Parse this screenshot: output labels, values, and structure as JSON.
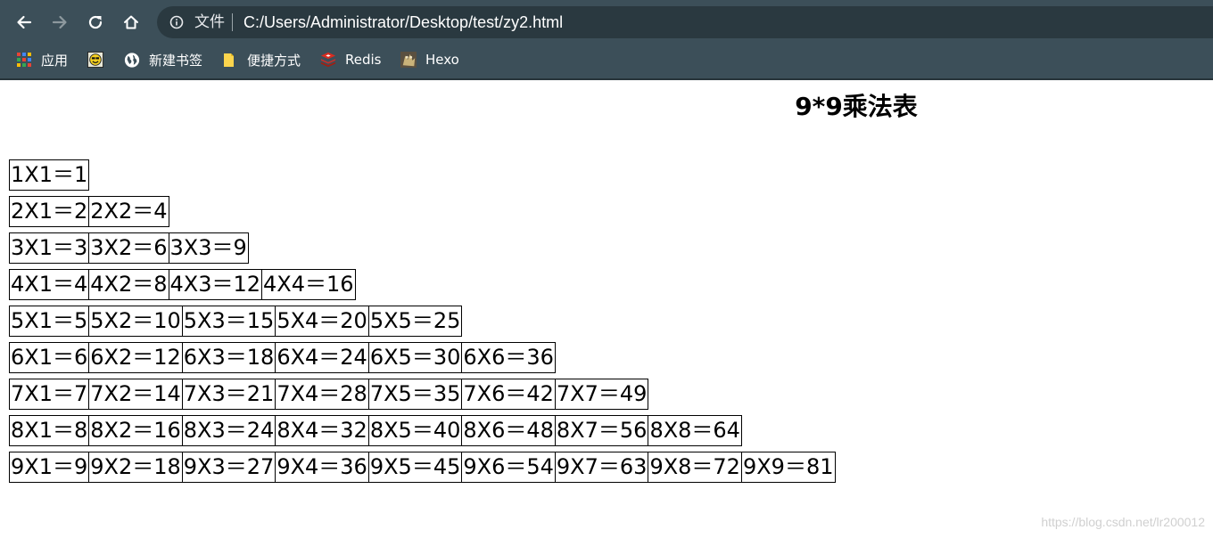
{
  "browser": {
    "url_scheme_label": "文件",
    "url": "C:/Users/Administrator/Desktop/test/zy2.html",
    "bookmarks": [
      {
        "label": "应用",
        "icon": "apps-grid-icon"
      },
      {
        "label": "",
        "icon": "smiley-image-icon"
      },
      {
        "label": "新建书签",
        "icon": "globe-icon"
      },
      {
        "label": "便捷方式",
        "icon": "folder-icon"
      },
      {
        "label": "Redis",
        "icon": "redis-icon"
      },
      {
        "label": "Hexo",
        "icon": "hexo-icon"
      }
    ]
  },
  "page": {
    "title": "9*9乘法表",
    "watermark": "https://blog.csdn.net/lr200012"
  },
  "table": {
    "rows": [
      [
        "1X1＝1"
      ],
      [
        "2X1＝2",
        "2X2＝4"
      ],
      [
        "3X1＝3",
        "3X2＝6",
        "3X3＝9"
      ],
      [
        "4X1＝4",
        "4X2＝8",
        "4X3＝12",
        "4X4＝16"
      ],
      [
        "5X1＝5",
        "5X2＝10",
        "5X3＝15",
        "5X4＝20",
        "5X5＝25"
      ],
      [
        "6X1＝6",
        "6X2＝12",
        "6X3＝18",
        "6X4＝24",
        "6X5＝30",
        "6X6＝36"
      ],
      [
        "7X1＝7",
        "7X2＝14",
        "7X3＝21",
        "7X4＝28",
        "7X5＝35",
        "7X6＝42",
        "7X7＝49"
      ],
      [
        "8X1＝8",
        "8X2＝16",
        "8X3＝24",
        "8X4＝32",
        "8X5＝40",
        "8X6＝48",
        "8X7＝56",
        "8X8＝64"
      ],
      [
        "9X1＝9",
        "9X2＝18",
        "9X3＝27",
        "9X4＝36",
        "9X5＝45",
        "9X6＝54",
        "9X7＝63",
        "9X8＝72",
        "9X9＝81"
      ]
    ]
  }
}
